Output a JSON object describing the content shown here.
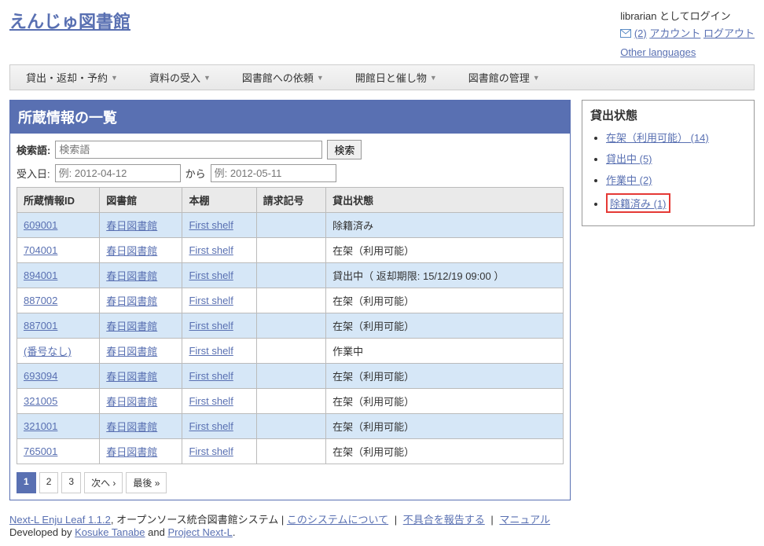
{
  "header": {
    "site_title": "えんじゅ図書館",
    "login_text": "librarian としてログイン",
    "notif_count": "(2)",
    "account": "アカウント",
    "logout": "ログアウト",
    "other_languages": "Other languages"
  },
  "nav": {
    "items": [
      "貸出・返却・予約",
      "資料の受入",
      "図書館への依頼",
      "開館日と催し物",
      "図書館の管理"
    ]
  },
  "page": {
    "title": "所蔵情報の一覧",
    "search_label": "検索語:",
    "search_placeholder": "検索語",
    "search_button": "検索",
    "acq_date_label": "受入日:",
    "date_from_placeholder": "例: 2012-04-12",
    "date_to_label": "から",
    "date_to_placeholder": "例: 2012-05-11"
  },
  "table": {
    "headers": [
      "所蔵情報ID",
      "図書館",
      "本棚",
      "請求記号",
      "貸出状態"
    ],
    "rows": [
      {
        "id": "609001",
        "library": "春日図書館",
        "shelf": "First shelf",
        "call": "",
        "status": "除籍済み"
      },
      {
        "id": "704001",
        "library": "春日図書館",
        "shelf": "First shelf",
        "call": "",
        "status": "在架（利用可能）"
      },
      {
        "id": "894001",
        "library": "春日図書館",
        "shelf": "First shelf",
        "call": "",
        "status": "貸出中（ 返却期限: 15/12/19 09:00 ）"
      },
      {
        "id": "887002",
        "library": "春日図書館",
        "shelf": "First shelf",
        "call": "",
        "status": "在架（利用可能）"
      },
      {
        "id": "887001",
        "library": "春日図書館",
        "shelf": "First shelf",
        "call": "",
        "status": "在架（利用可能）"
      },
      {
        "id": "(番号なし)",
        "library": "春日図書館",
        "shelf": "First shelf",
        "call": "",
        "status": "作業中"
      },
      {
        "id": "693094",
        "library": "春日図書館",
        "shelf": "First shelf",
        "call": "",
        "status": "在架（利用可能）"
      },
      {
        "id": "321005",
        "library": "春日図書館",
        "shelf": "First shelf",
        "call": "",
        "status": "在架（利用可能）"
      },
      {
        "id": "321001",
        "library": "春日図書館",
        "shelf": "First shelf",
        "call": "",
        "status": "在架（利用可能）"
      },
      {
        "id": "765001",
        "library": "春日図書館",
        "shelf": "First shelf",
        "call": "",
        "status": "在架（利用可能）"
      }
    ]
  },
  "pagination": {
    "p1": "1",
    "p2": "2",
    "p3": "3",
    "next": "次へ ›",
    "last": "最後 »"
  },
  "sidebar": {
    "title": "貸出状態",
    "items": [
      "在架（利用可能） (14)",
      "貸出中 (5)",
      "作業中 (2)",
      "除籍済み (1)"
    ]
  },
  "footer": {
    "product": "Next-L Enju Leaf 1.1.2",
    "desc": ", オープンソース統合図書館システム | ",
    "about": "このシステムについて",
    "report": "不具合を報告する",
    "manual": "マニュアル",
    "dev_by": "Developed by ",
    "author": "Kosuke Tanabe",
    "and": " and ",
    "project": "Project Next-L",
    "period": "."
  }
}
